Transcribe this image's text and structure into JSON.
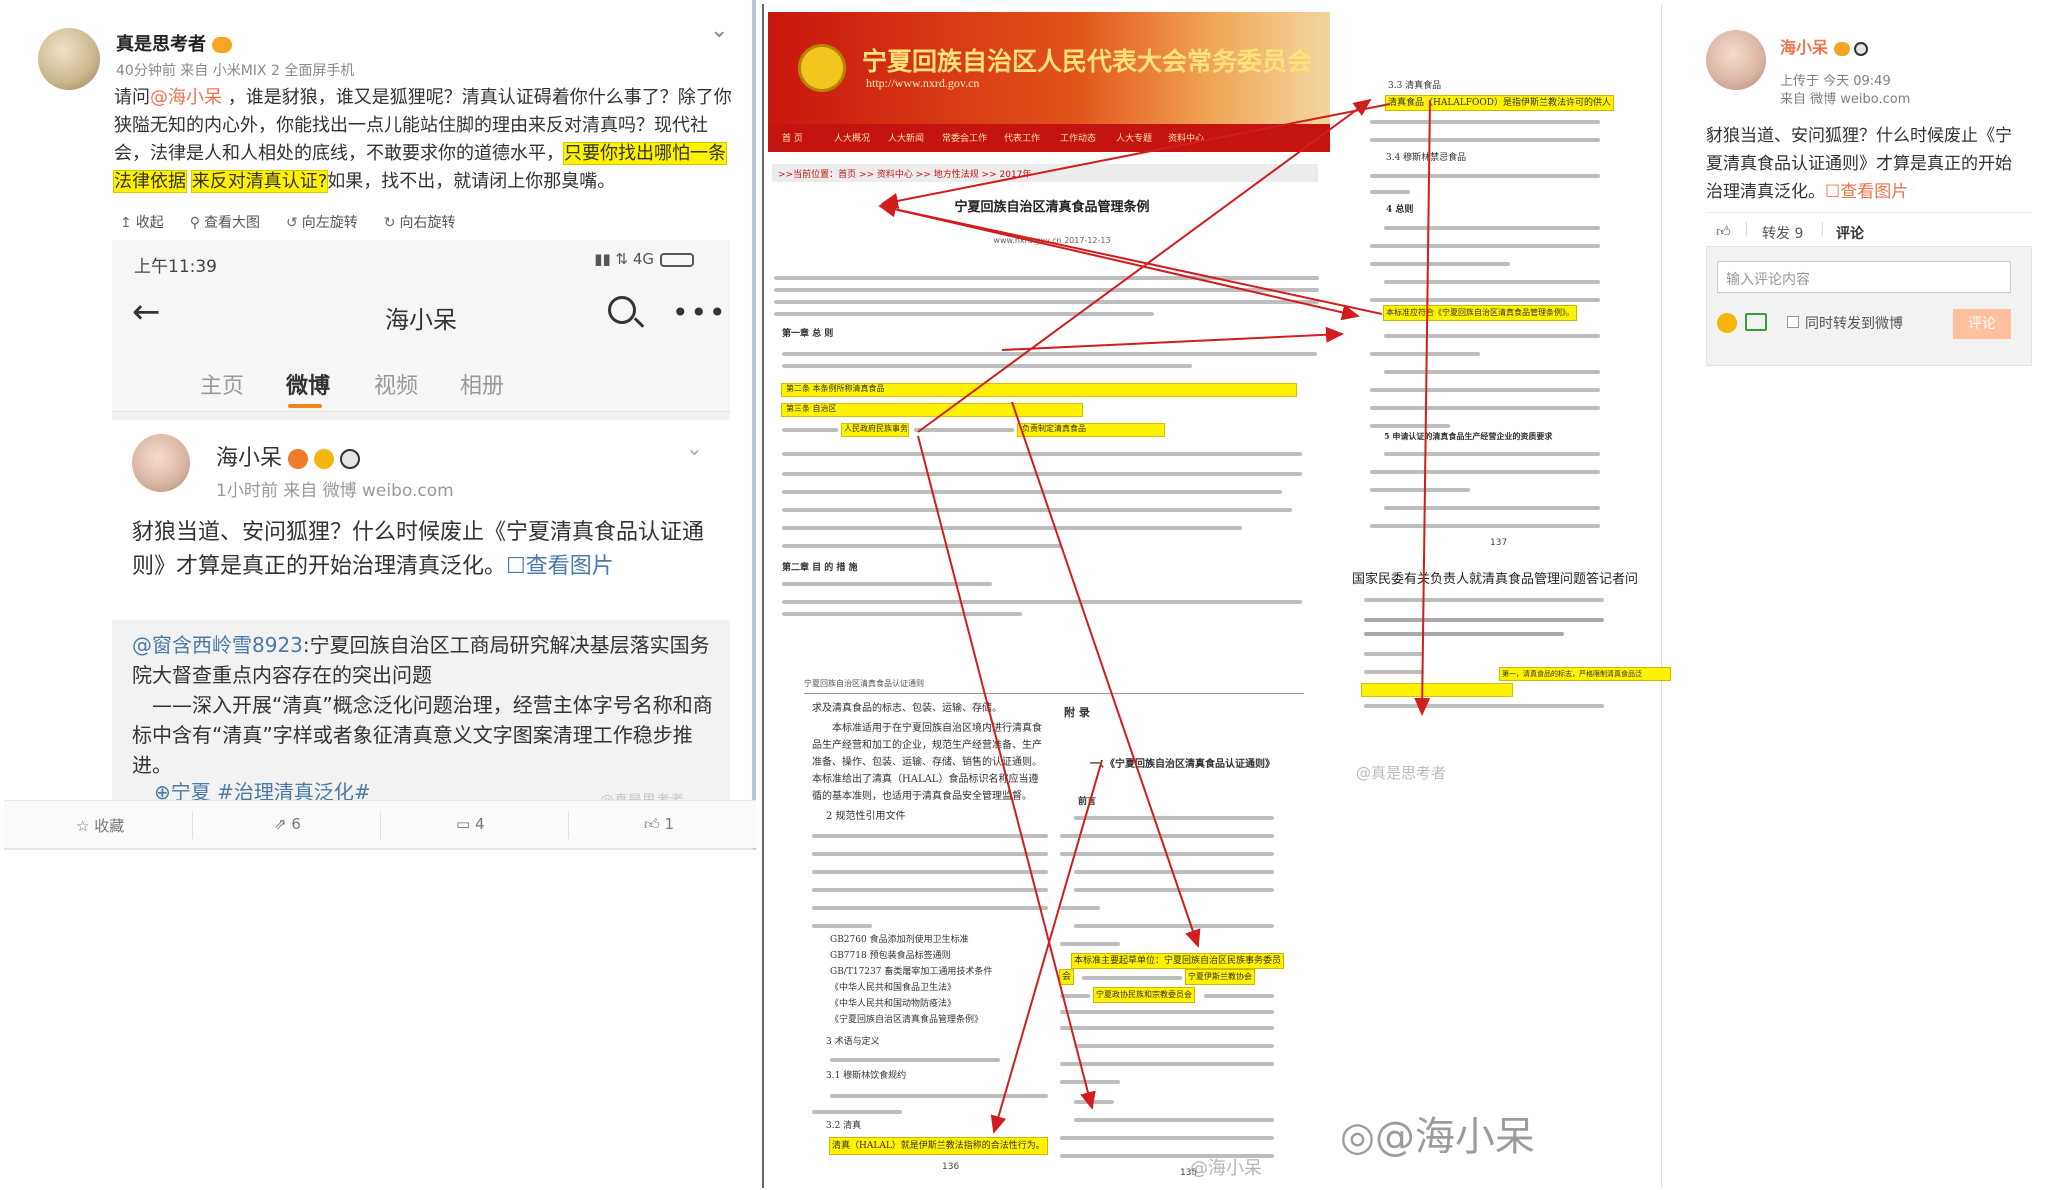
{
  "left_post": {
    "username": "真是思考者",
    "meta": "40分钟前 来自 小米MIX 2 全面屏手机",
    "text_before_mention": "请问",
    "mention": "@海小呆",
    "text_main": " ，谁是豺狼，谁又是狐狸呢？清真认证碍着你什么事了？除了你狭隘无知的内心外，你能找出一点儿能站住脚的理由来反对清真吗？现代社会，法律是人和人相处的底线，不敢要求你的道德水平，",
    "text_highlight_1": "只要你找出哪怕一条法律依据",
    "text_highlight_2": "来反对清真认证?",
    "text_end": "如果，找不出，就请闭上你那臭嘴。",
    "actions": [
      "收起",
      "查看大图",
      "向左旋转",
      "向右旋转"
    ]
  },
  "phone": {
    "time": "上午11:39",
    "signal": "4G",
    "title": "海小呆",
    "tabs": [
      "主页",
      "微博",
      "视频",
      "相册"
    ],
    "active_tab": "微博",
    "post_user": "海小呆",
    "post_meta": "1小时前  来自 微博 weibo.com",
    "post_body": "豺狼当道、安问狐狸？什么时候废止《宁夏清真食品认证通则》才算是真正的开始治理清真泛化。",
    "view_image": "☐查看图片",
    "repost_user": "@窗含西岭雪8923",
    "repost_text": ":宁夏回族自治区工商局研究解决基层落实国务院大督查重点内容存在的突出问题",
    "repost_line2": "——深入开展“清真”概念泛化问题治理，经营主体字号名称和商标中含有“清真”字样或者象征清真意义文字图案清理工作稳步推进。",
    "repost_tag": "宁夏 #治理清真泛化#",
    "watermark": "@真是思考者"
  },
  "left_bottom": {
    "fav": "收藏",
    "repost": "6",
    "comment": "4",
    "like": "1"
  },
  "document": {
    "site_title": "宁夏回族自治区人民代表大会常务委员会",
    "site_url": "http://www.nxrd.gov.cn",
    "menu": [
      "首 页",
      "人大概况",
      "人大新闻",
      "常委会工作",
      "代表工作",
      "工作动态",
      "人大专题",
      "资料中心"
    ],
    "breadcrumb": ">>当前位置：首页 >> 资料中心 >> 地方性法规 >> 2017年",
    "page_title": "宁夏回族自治区清真食品管理条例",
    "page_source": "www.nxrd.gov.cn    2017-12-13",
    "p1_section1": "第一章 总 则",
    "p1_section2": "第二章 目 的 措 施",
    "p1_hl_1": "第二条 本条例所称清真食品",
    "p1_hl_2": "第三条 自治区",
    "p1_hl_3": "人民政府民族事务",
    "p1_hl_4": "负责制定清真食品",
    "p2_header": "宁夏回族自治区清真食品认证通则",
    "p2_intro": "求及清真食品的标志、包装、运输、存储。",
    "p2_para": "本标准适用于在宁夏回族自治区境内进行清真食品生产经营和加工的企业，规范生产经营准备、生产准备、操作、包装、运输、存储、销售的认证通则。本标准给出了清真（HALAL）食品标识名称应当遵循的基本准则，也适用于清真食品安全管理监督。",
    "p2_s2": "2  规范性引用文件",
    "p2_refs": [
      "GB2760 食品添加剂使用卫生标准",
      "GB7718 预包装食品标签通则",
      "GB/T17237 畜类屠宰加工通用技术条件",
      "《中华人民共和国食品卫生法》",
      "《中华人民共和国动物防疫法》",
      "《宁夏回族自治区清真食品管理条例》"
    ],
    "p2_s3": "3  术语与定义",
    "p2_s31": "3.1  穆斯林饮食规约",
    "p2_s32": "3.2  清真",
    "p2_hl_end": "清真（HALAL）就是伊斯兰教法指称的合法性行为。",
    "p2_num": "136",
    "appendix": "附  录",
    "appendix_title": "一、《宁夏回族自治区清真食品认证通则》",
    "preface": "前言",
    "p3_hl_1": "本标准主要起草单位：宁夏回族自治区民族事务委员",
    "p3_hl_2": "会",
    "p3_hl_3": "宁夏伊斯兰教协会",
    "p3_hl_4": "宁夏政协民族和宗教委员会",
    "p3_num": "135",
    "r_s33": "3.3  清真食品",
    "r_hl_1": "清真食品（HALALFOOD）是指伊斯兰教法许可的供人",
    "r_s34": "3.4  穆斯林禁忌食品",
    "r_s4": "4  总则",
    "r_hl_2": "本标准应符合《宁夏回族自治区清真食品管理条例》。",
    "r_s5": "5  申请认证的清真食品生产经营企业的资质要求",
    "r_num": "137",
    "r_news_title": "国家民委有关负责人就清真食品管理问题答记者问",
    "r_hl_news": "第一，清真食品的标志，严格限制清真食品泛"
  },
  "right_post": {
    "username": "海小呆",
    "time": "上传于 今天 09:49",
    "source": "来自 微博 weibo.com",
    "body": "豺狼当道、安问狐狸？什么时候废止《宁夏清真食品认证通则》才算是真正的开始治理清真泛化。",
    "view_image": "☐查看图片",
    "repost": "转发 9",
    "comment_tab": "评论",
    "comment_placeholder": "输入评论内容",
    "sync_label": "同时转发到微博",
    "submit": "评论"
  },
  "watermarks": {
    "big": "@海小呆",
    "small": "@海小呆"
  },
  "colors": {
    "weibo_orange": "#eb7350",
    "link_blue": "#4a7aa8",
    "highlight_yellow": "#fff200",
    "npc_red": "#c8160e"
  }
}
